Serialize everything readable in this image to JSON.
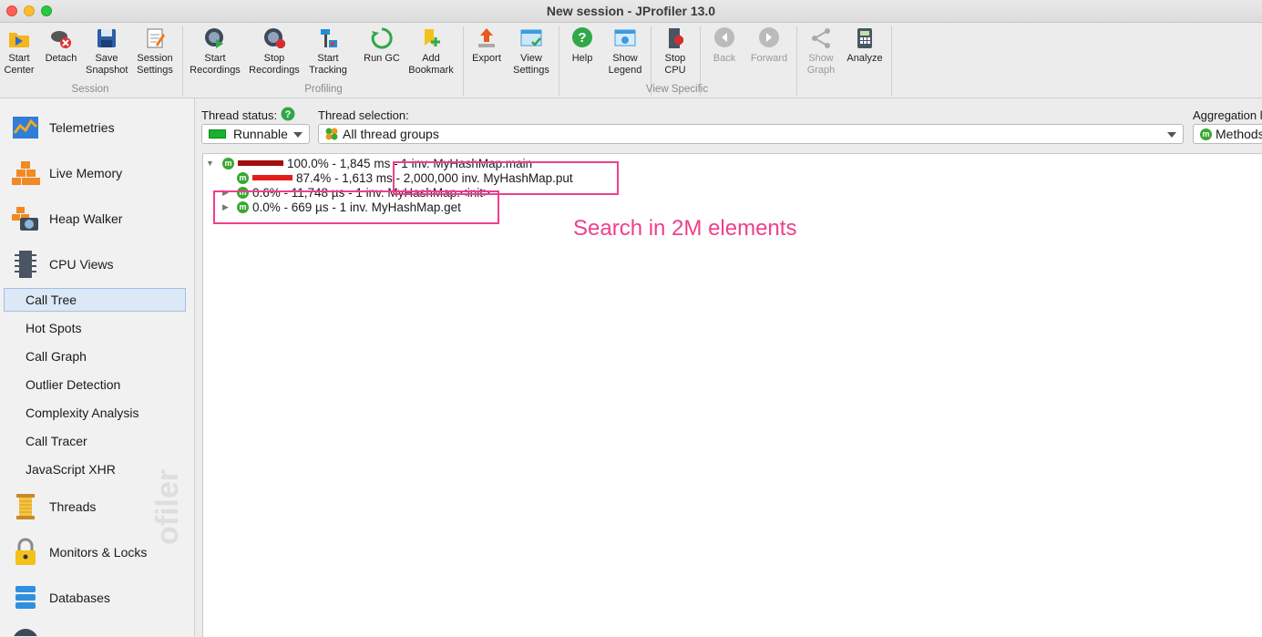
{
  "window": {
    "title": "New session - JProfiler 13.0"
  },
  "toolbar": {
    "groups": [
      "Session",
      "Profiling",
      "View Specific"
    ],
    "buttons": [
      {
        "label1": "Start",
        "label2": "Center",
        "icon": "start-center-icon"
      },
      {
        "label1": "Detach",
        "label2": "",
        "icon": "detach-icon"
      },
      {
        "label1": "Save",
        "label2": "Snapshot",
        "icon": "save-snapshot-icon"
      },
      {
        "label1": "Session",
        "label2": "Settings",
        "icon": "session-settings-icon"
      },
      {
        "label1": "Start",
        "label2": "Recordings",
        "icon": "start-recordings-icon"
      },
      {
        "label1": "Stop",
        "label2": "Recordings",
        "icon": "stop-recordings-icon"
      },
      {
        "label1": "Start",
        "label2": "Tracking",
        "icon": "start-tracking-icon"
      },
      {
        "label1": "Run GC",
        "label2": "",
        "icon": "run-gc-icon"
      },
      {
        "label1": "Add",
        "label2": "Bookmark",
        "icon": "add-bookmark-icon"
      },
      {
        "label1": "Export",
        "label2": "",
        "icon": "export-icon"
      },
      {
        "label1": "View",
        "label2": "Settings",
        "icon": "view-settings-icon"
      },
      {
        "label1": "Help",
        "label2": "",
        "icon": "help-icon"
      },
      {
        "label1": "Show",
        "label2": "Legend",
        "icon": "show-legend-icon"
      },
      {
        "label1": "Stop",
        "label2": "CPU",
        "icon": "stop-cpu-icon"
      },
      {
        "label1": "Back",
        "label2": "",
        "icon": "back-icon"
      },
      {
        "label1": "Forward",
        "label2": "",
        "icon": "forward-icon"
      },
      {
        "label1": "Show",
        "label2": "Graph",
        "icon": "show-graph-icon"
      },
      {
        "label1": "Analyze",
        "label2": "",
        "icon": "analyze-icon"
      }
    ]
  },
  "sidebar": {
    "main": [
      "Telemetries",
      "Live Memory",
      "Heap Walker",
      "CPU Views",
      "Threads",
      "Monitors & Locks",
      "Databases"
    ],
    "cpu_views": [
      "Call Tree",
      "Hot Spots",
      "Call Graph",
      "Outlier Detection",
      "Complexity Analysis",
      "Call Tracer",
      "JavaScript XHR"
    ],
    "selected": "Call Tree",
    "watermark": "ofiler"
  },
  "filters": {
    "thread_status_label": "Thread status:",
    "thread_status_value": "Runnable",
    "thread_selection_label": "Thread selection:",
    "thread_selection_value": "All thread groups",
    "aggregation_label": "Aggregation l",
    "aggregation_value": "Methods"
  },
  "tree": {
    "rows": [
      {
        "text": "100.0% - 1,845 ms - 1 inv. MyHashMap.main",
        "percent": 100.0,
        "expanded": true
      },
      {
        "text": "87.4% - 1,613 ms - 2,000,000 inv. MyHashMap.put",
        "percent": 87.4,
        "expanded": false
      },
      {
        "text": "0.6% - 11,748 µs - 1 inv. MyHashMap.<init>",
        "percent": 0.6,
        "expanded": false
      },
      {
        "text": "0.0% - 669 µs - 1 inv. MyHashMap.get",
        "percent": 0.0,
        "expanded": false
      }
    ],
    "badge": "m"
  },
  "annotation": {
    "text": "Search in 2M elements",
    "color": "#ee3f8d"
  },
  "colors": {
    "bar_main": "#a30d0d",
    "bar_put": "#e41b1b",
    "accent_select": "#dce8f6",
    "badge": "#3aa832"
  }
}
